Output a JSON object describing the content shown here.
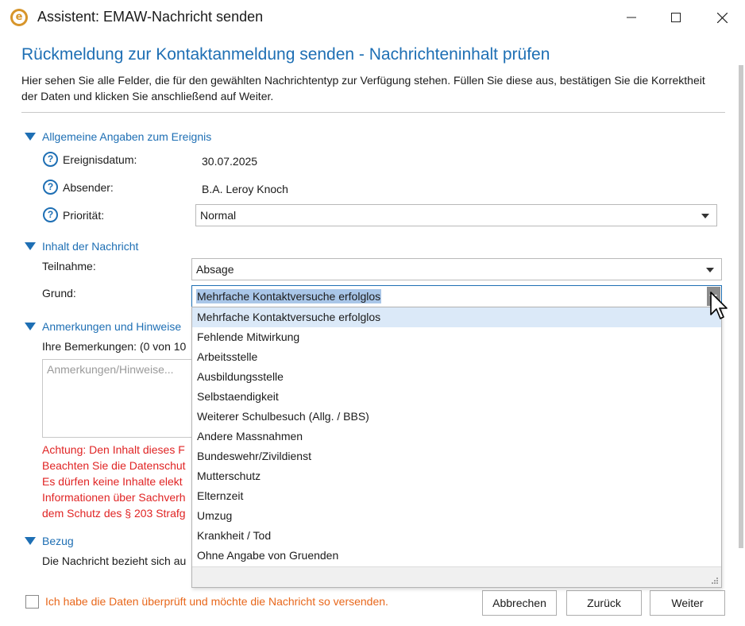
{
  "window": {
    "title": "Assistent: EMAW-Nachricht senden",
    "app_icon": "e-logo-icon"
  },
  "header": {
    "heading": "Rückmeldung zur Kontaktanmeldung senden - Nachrichteninhalt prüfen",
    "description": "Hier sehen Sie alle Felder, die für den gewählten Nachrichtentyp zur Verfügung stehen. Füllen Sie diese aus, bestätigen Sie die Korrektheit der Daten und klicken Sie anschließend auf Weiter."
  },
  "sections": {
    "allgemein": {
      "title": "Allgemeine Angaben zum Ereignis",
      "fields": {
        "datum_label": "Ereignisdatum:",
        "datum_value": "30.07.2025",
        "absender_label": "Absender:",
        "absender_value": "B.A. Leroy Knoch",
        "prioritaet_label": "Priorität:",
        "prioritaet_value": "Normal"
      }
    },
    "inhalt": {
      "title": "Inhalt der Nachricht",
      "teilnahme_label": "Teilnahme:",
      "teilnahme_value": "Absage",
      "grund_label": "Grund:",
      "grund_value": "Mehrfache Kontaktversuche erfolglos"
    },
    "anmerkungen": {
      "title": "Anmerkungen und Hinweise",
      "bemerkungen_label": "Ihre Bemerkungen: (0 von 10",
      "placeholder": "Anmerkungen/Hinweise...",
      "warning_lines": [
        "Achtung: Den Inhalt dieses F",
        "Beachten Sie die Datenschut",
        "Es dürfen keine Inhalte elekt",
        "Informationen über Sachverh",
        "dem Schutz des § 203 Strafg"
      ]
    },
    "bezug": {
      "title": "Bezug",
      "text": "Die Nachricht bezieht sich au"
    }
  },
  "dropdown": {
    "selected": "Mehrfache Kontaktversuche erfolglos",
    "options": [
      "Mehrfache Kontaktversuche erfolglos",
      "Fehlende Mitwirkung",
      "Arbeitsstelle",
      "Ausbildungsstelle",
      "Selbstaendigkeit",
      "Weiterer Schulbesuch (Allg. / BBS)",
      "Andere Massnahmen",
      "Bundeswehr/Zivildienst",
      "Mutterschutz",
      "Elternzeit",
      "Umzug",
      "Krankheit / Tod",
      "Ohne Angabe von Gruenden"
    ]
  },
  "footer": {
    "confirm_text": "Ich habe die Daten überprüft und möchte die Nachricht so versenden.",
    "cancel_label": "Abbrechen",
    "back_label": "Zurück",
    "next_label": "Weiter"
  },
  "colors": {
    "accent": "#1e6fb4",
    "warning": "#e02424",
    "confirm": "#e8671b",
    "highlight": "#dbe9f8",
    "selection": "#a9c6e8"
  }
}
